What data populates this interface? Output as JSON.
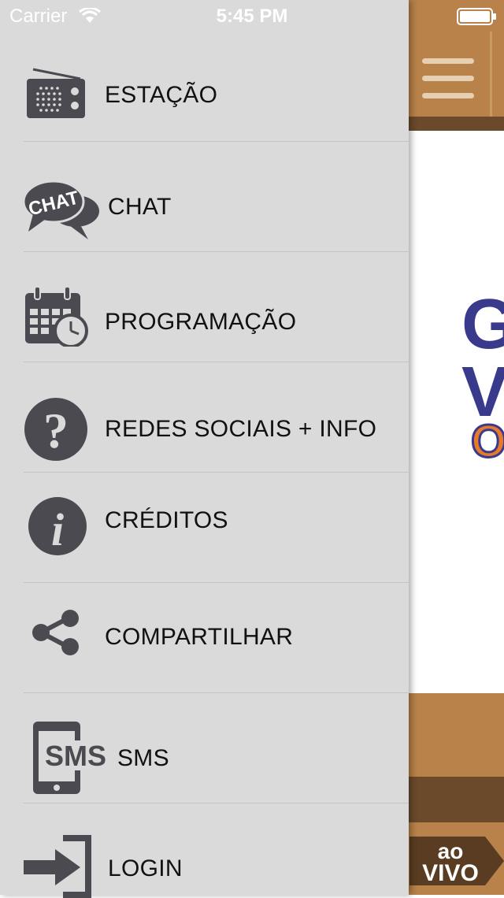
{
  "status_bar": {
    "carrier": "Carrier",
    "time": "5:45 PM"
  },
  "menu": {
    "items": [
      {
        "label": "ESTAÇÃO",
        "icon": "radio-icon"
      },
      {
        "label": "CHAT",
        "icon": "chat-icon",
        "icon_text": "CHAT"
      },
      {
        "label": "PROGRAMAÇÃO",
        "icon": "calendar-clock-icon"
      },
      {
        "label": "REDES SOCIAIS + INFO",
        "icon": "question-icon"
      },
      {
        "label": "CRÉDITOS",
        "icon": "info-icon"
      },
      {
        "label": "COMPARTILHAR",
        "icon": "share-icon"
      },
      {
        "label": "SMS",
        "icon": "sms-phone-icon",
        "icon_text": "SMS"
      },
      {
        "label": "LOGIN",
        "icon": "login-icon"
      }
    ]
  },
  "app": {
    "live_button": {
      "line1": "ao",
      "line2": "VIVO"
    },
    "colors": {
      "bar_light": "#b8824a",
      "bar_dark": "#6b4a2b",
      "drawer_bg": "#dadada",
      "icon_dark": "#4a4a50",
      "logo_blue": "#3a3a8c",
      "logo_orange": "#e8782a"
    }
  }
}
